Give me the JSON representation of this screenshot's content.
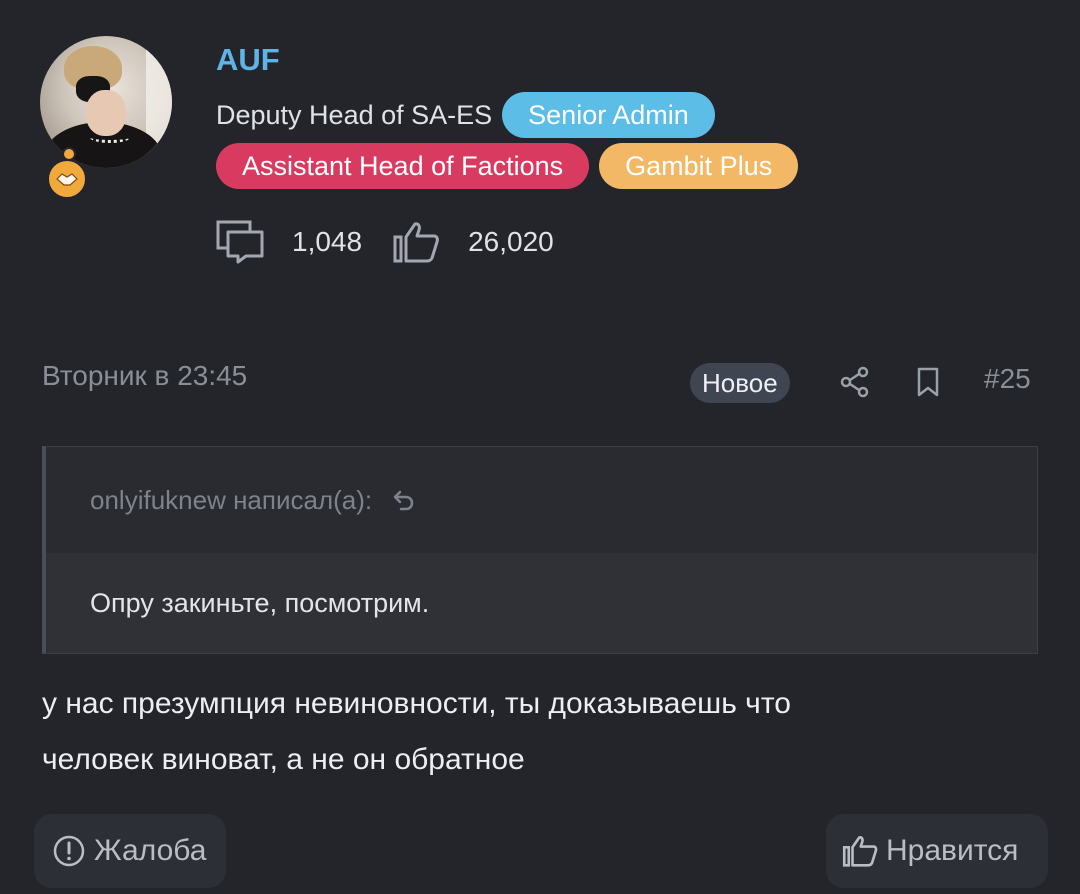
{
  "user": {
    "username": "AUF",
    "title": "Deputy Head of SA-ES",
    "tags": [
      {
        "label": "Senior Admin",
        "color": "#5cbde6"
      },
      {
        "label": "Assistant Head of Factions",
        "color": "#d93b60"
      },
      {
        "label": "Gambit Plus",
        "color": "#f3b866"
      }
    ],
    "stats": {
      "messages": "1,048",
      "reactions": "26,020"
    }
  },
  "post": {
    "date": "Вторник в 23:45",
    "new_label": "Новое",
    "number": "#25",
    "quote": {
      "header": "onlyifuknew написал(а):",
      "text": "Опру закиньте, посмотрим."
    },
    "message_line1": "у нас презумпция невиновности, ты доказываешь что",
    "message_line2": "человек виноват, а не он обратное"
  },
  "actions": {
    "report_label": "Жалоба",
    "like_label": "Нравится"
  },
  "colors": {
    "background": "#23252b",
    "username": "#5fb4e6"
  }
}
